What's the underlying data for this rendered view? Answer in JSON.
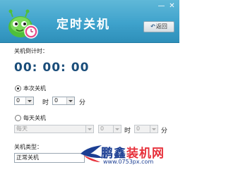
{
  "window": {
    "title": "定时关机",
    "min_glyph": "—",
    "close_glyph": "✕",
    "back_label": "返回",
    "accent": "#3ea2cc"
  },
  "countdown": {
    "label": "关机倒计时：",
    "value": "00: 00: 00"
  },
  "once": {
    "label": "本次关机",
    "selected": true,
    "hour_value": "0",
    "hour_unit": "时",
    "minute_value": "0",
    "minute_unit": "分"
  },
  "daily": {
    "label": "每天关机",
    "selected": false,
    "frequency_value": "每天",
    "hour_value": "0",
    "hour_unit": "时",
    "minute_value": "0",
    "minute_unit": "分"
  },
  "type": {
    "label": "关机类型：",
    "value": "正常关机"
  },
  "watermark": {
    "brand_blue": "鹏鑫",
    "brand_red": "装机网",
    "url": "www.0753px.com"
  }
}
